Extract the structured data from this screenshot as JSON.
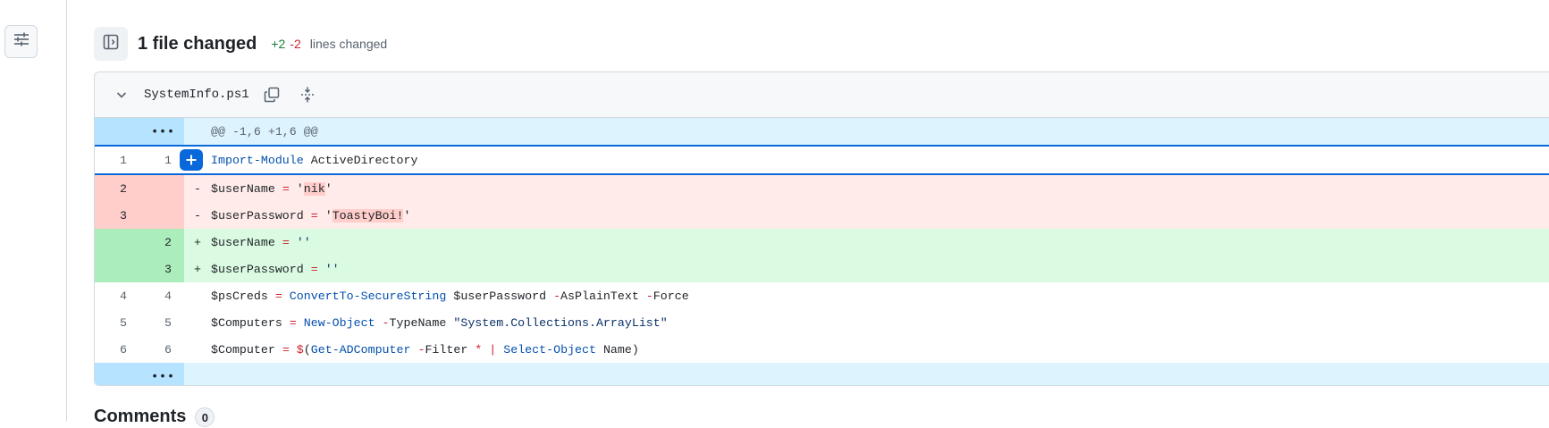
{
  "summary": {
    "files_changed": "1 file changed",
    "additions": "+2",
    "deletions": "-2",
    "lines_changed": "lines changed"
  },
  "file": {
    "name": "SystemInfo.ps1"
  },
  "hunk": {
    "header": "@@ -1,6 +1,6 @@",
    "expand_glyph": "•••"
  },
  "rows": [
    {
      "type": "context",
      "old": "1",
      "new": "1",
      "marker": "",
      "segments": [
        [
          "kw",
          "Import-Module"
        ],
        [
          "plain",
          " ActiveDirectory"
        ]
      ]
    },
    {
      "type": "del",
      "old": "2",
      "new": "",
      "marker": "-",
      "segments": [
        [
          "plain",
          "$userName "
        ],
        [
          "op",
          "="
        ],
        [
          "plain",
          " '"
        ],
        [
          "hl",
          "nik"
        ],
        [
          "plain",
          "'"
        ]
      ]
    },
    {
      "type": "del",
      "old": "3",
      "new": "",
      "marker": "-",
      "segments": [
        [
          "plain",
          "$userPassword "
        ],
        [
          "op",
          "="
        ],
        [
          "plain",
          " '"
        ],
        [
          "hl",
          "ToastyBoi!"
        ],
        [
          "plain",
          "'"
        ]
      ]
    },
    {
      "type": "add",
      "old": "",
      "new": "2",
      "marker": "+",
      "segments": [
        [
          "plain",
          "$userName "
        ],
        [
          "op",
          "="
        ],
        [
          "str",
          " ''"
        ]
      ]
    },
    {
      "type": "add",
      "old": "",
      "new": "3",
      "marker": "+",
      "segments": [
        [
          "plain",
          "$userPassword "
        ],
        [
          "op",
          "="
        ],
        [
          "str",
          " ''"
        ]
      ]
    },
    {
      "type": "context",
      "old": "4",
      "new": "4",
      "marker": "",
      "segments": [
        [
          "plain",
          "$psCreds "
        ],
        [
          "op",
          "="
        ],
        [
          "kw",
          " ConvertTo-SecureString"
        ],
        [
          "plain",
          " $userPassword "
        ],
        [
          "op",
          "-"
        ],
        [
          "plain",
          "AsPlainText "
        ],
        [
          "op",
          "-"
        ],
        [
          "plain",
          "Force"
        ]
      ]
    },
    {
      "type": "context",
      "old": "5",
      "new": "5",
      "marker": "",
      "segments": [
        [
          "plain",
          "$Computers "
        ],
        [
          "op",
          "="
        ],
        [
          "kw",
          " New-Object"
        ],
        [
          "plain",
          " "
        ],
        [
          "op",
          "-"
        ],
        [
          "plain",
          "TypeName "
        ],
        [
          "str",
          "\"System.Collections.ArrayList\""
        ]
      ]
    },
    {
      "type": "context",
      "old": "6",
      "new": "6",
      "marker": "",
      "segments": [
        [
          "plain",
          "$Computer "
        ],
        [
          "op",
          "= $"
        ],
        [
          "plain",
          "("
        ],
        [
          "kw",
          "Get-ADComputer"
        ],
        [
          "plain",
          " "
        ],
        [
          "op",
          "-"
        ],
        [
          "plain",
          "Filter "
        ],
        [
          "op",
          "* |"
        ],
        [
          "kw",
          " Select-Object"
        ],
        [
          "plain",
          " Name)"
        ]
      ]
    }
  ],
  "comments": {
    "heading": "Comments",
    "count": "0"
  },
  "colors": {
    "accent": "#0969da",
    "addition": "#1a7f37",
    "deletion": "#d1242f"
  },
  "icons": {
    "rail": "sliders-icon",
    "tree_toggle": "sidebar-expand-icon",
    "collapse": "chevron-down-icon",
    "copy": "copy-icon",
    "expand": "unfold-icon",
    "add_comment": "plus-icon"
  }
}
